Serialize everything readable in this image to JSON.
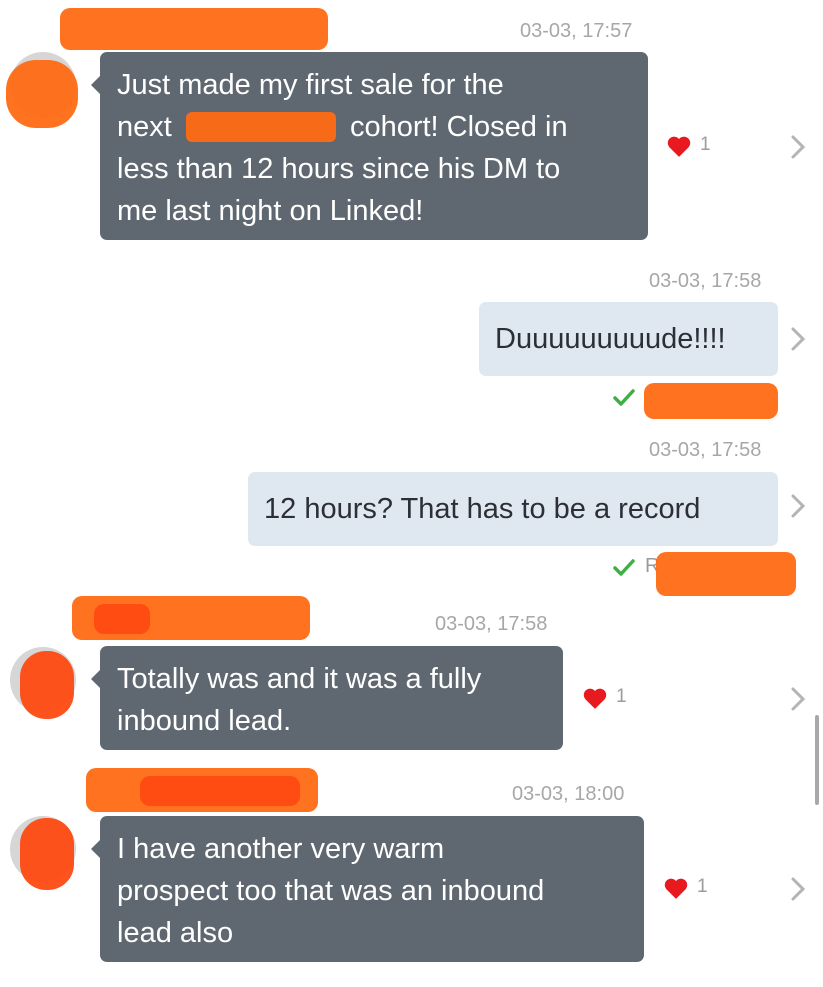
{
  "messages": [
    {
      "direction": "incoming",
      "timestamp": "03-03, 17:57",
      "text_lines": [
        "Just made my first sale for the",
        "next",
        "cohort! Closed in",
        "less than 12 hours since his DM to",
        "me last night on Linked!"
      ],
      "reactions": {
        "count": "1"
      }
    },
    {
      "direction": "outgoing",
      "timestamp": "03-03, 17:58",
      "text": "Duuuuuuuuude!!!!"
    },
    {
      "direction": "outgoing",
      "timestamp": "03-03, 17:58",
      "text": "12 hours? That has to be a record",
      "status_partial": "R"
    },
    {
      "direction": "incoming",
      "timestamp": "03-03, 17:58",
      "text_lines": [
        "Totally was and it was a fully",
        "inbound lead."
      ],
      "reactions": {
        "count": "1"
      }
    },
    {
      "direction": "incoming",
      "timestamp": "03-03, 18:00",
      "text_lines": [
        "I have another very warm",
        "prospect too that was an inbound",
        "lead also"
      ],
      "reactions": {
        "count": "1"
      }
    }
  ],
  "icons": {
    "heart": "heart-icon",
    "chevron": "chevron-right-icon",
    "check": "checkmark-icon"
  },
  "colors": {
    "incoming_bubble": "#5f6870",
    "outgoing_bubble": "#dfe8f1",
    "heart": "#e8191f",
    "check": "#3cb043",
    "redaction": "#ff6a13"
  }
}
